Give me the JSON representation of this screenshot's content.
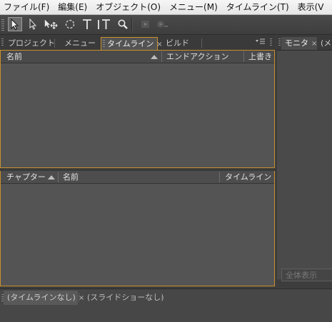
{
  "menubar": {
    "items": [
      "ファイル(F)",
      "編集(E)",
      "オブジェクト(O)",
      "メニュー(M)",
      "タイムライン(T)",
      "表示(V"
    ]
  },
  "toolbar": {
    "tools": [
      "selection-tool",
      "direct-select-tool",
      "move-tool",
      "rotate-tool",
      "text-tool",
      "vertical-text-tool",
      "zoom-tool",
      "preview-tool",
      "preview-from-here-tool"
    ]
  },
  "left_panel": {
    "tabs": [
      {
        "label": "プロジェクト",
        "active": false
      },
      {
        "label": "メニュー",
        "active": false
      },
      {
        "label": "タイムライン",
        "active": true,
        "close": "×"
      },
      {
        "label": "ビルド",
        "active": false
      }
    ],
    "timeline_columns": [
      "名前",
      "エンドアクション",
      "上書き"
    ],
    "chapter_columns": [
      "チャプター ...",
      "名前",
      "タイムライン"
    ]
  },
  "right_panel": {
    "tabs": [
      {
        "label": "モニタ",
        "close": "×"
      },
      {
        "label": "(メ"
      }
    ],
    "fit_button": "全体表示"
  },
  "bottom_panel": {
    "tabs": [
      {
        "label": "(タイムラインなし)",
        "active": true,
        "close": "×"
      },
      {
        "label": "(スライドショーなし)",
        "active": false
      }
    ]
  },
  "colors": {
    "accent_border": "#c8902d",
    "panel_bg": "#545454",
    "menubar_bg": "#f0f0f0"
  }
}
